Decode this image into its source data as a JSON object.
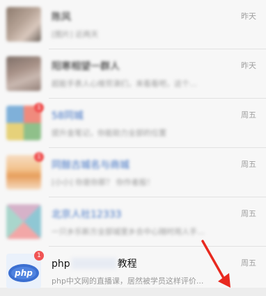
{
  "chats": [
    {
      "name": "陈风",
      "preview": "[图片]        近两天",
      "time": "昨天",
      "avatar_colors": [
        "#8d7b6e",
        "#b7a497",
        "#d9c8bd",
        "#6f665f"
      ],
      "badge": ""
    },
    {
      "name": "阳寒相望一群人",
      "preview": "超能手表人心维劳演们，来看看吧，这个…",
      "time": "昨天",
      "avatar_colors": [
        "#7e6f68",
        "#a89288",
        "#c9b8b0",
        "#948179"
      ],
      "badge": ""
    },
    {
      "name": "58同城",
      "preview": "提升金笔记，你能助力全部的位置",
      "time": "周五",
      "avatar_colors": [
        "#f08a7d",
        "#8fc08a",
        "#e6d17a",
        "#7fb0d9"
      ],
      "badge": "1"
    },
    {
      "name": "同鼓古城名与商城",
      "preview": "[小小] 你是你那？ 你作者般！",
      "time": "周五",
      "avatar_colors": [
        "#f3c48f",
        "#e79e5c",
        "#f6dcc2",
        "#f09a7a"
      ],
      "badge": "1"
    },
    {
      "name": "北京人社12333",
      "preview": "一只乡乐新方全部城里乡合中心随时用人手…",
      "time": "周五",
      "avatar_colors": [
        "#8fc7d4",
        "#f2a7a7",
        "#a9d6cc",
        "#d6b2c9"
      ],
      "badge": ""
    },
    {
      "name_prefix": "php",
      "name_suffix": "教程",
      "preview": "php中文网的直播课，居然被学员这样评价...",
      "time": "周五",
      "avatar_label": "php",
      "badge": "1"
    }
  ],
  "icons": {
    "annotation_arrow": "red-arrow-icon"
  },
  "colors": {
    "badge": "#f05454",
    "arrow": "#e8291f",
    "php_avatar": "#3b6fd1"
  }
}
